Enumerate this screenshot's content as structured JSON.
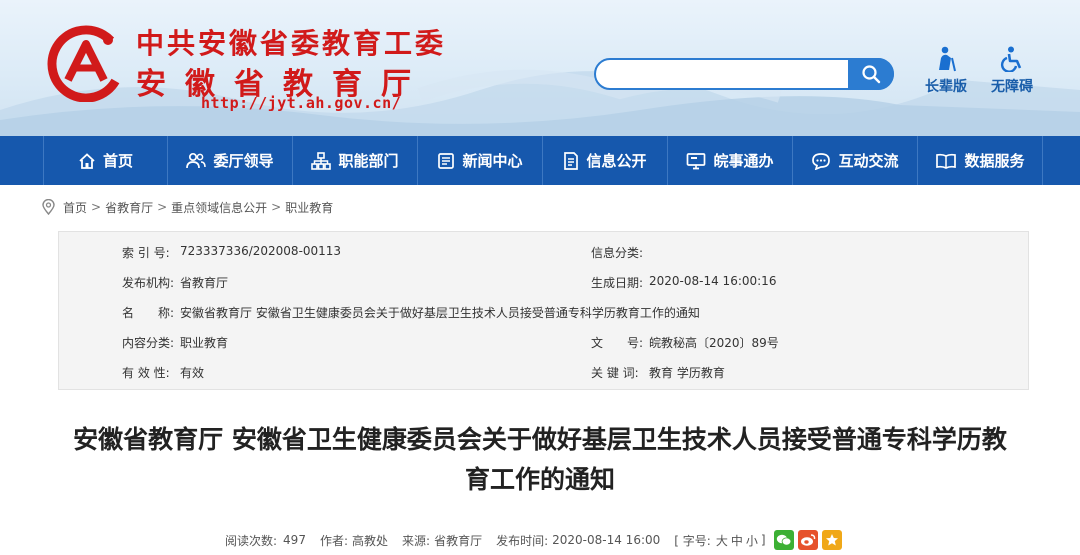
{
  "site": {
    "name_line1": "中共安徽省委教育工委",
    "name_line2": "安徽省教育厅",
    "url": "http://jyt.ah.gov.cn/",
    "brand_red": "#d11a1a",
    "nav_blue": "#1658ad"
  },
  "search": {
    "placeholder": "",
    "value": "",
    "icon": "search-icon"
  },
  "utilities": [
    {
      "label": "长辈版",
      "icon": "elder-icon"
    },
    {
      "label": "无障碍",
      "icon": "wheelchair-icon"
    }
  ],
  "nav": [
    {
      "label": "首页",
      "icon": "home-icon"
    },
    {
      "label": "委厅领导",
      "icon": "leaders-icon"
    },
    {
      "label": "职能部门",
      "icon": "org-chart-icon"
    },
    {
      "label": "新闻中心",
      "icon": "newspaper-icon"
    },
    {
      "label": "信息公开",
      "icon": "document-icon"
    },
    {
      "label": "皖事通办",
      "icon": "monitor-icon"
    },
    {
      "label": "互动交流",
      "icon": "chat-icon"
    },
    {
      "label": "数据服务",
      "icon": "book-icon"
    }
  ],
  "breadcrumb": [
    "首页",
    "省教育厅",
    "重点领域信息公开",
    "职业教育"
  ],
  "info": {
    "index_label": "索 引 号:",
    "index_value": "723337336/202008-00113",
    "category_label": "信息分类:",
    "category_value": "",
    "publisher_label": "发布机构:",
    "publisher_value": "省教育厅",
    "date_label": "生成日期:",
    "date_value": "2020-08-14 16:00:16",
    "name_label": "名　　称:",
    "name_value": "安徽省教育厅 安徽省卫生健康委员会关于做好基层卫生技术人员接受普通专科学历教育工作的通知",
    "content_label": "内容分类:",
    "content_value": "职业教育",
    "docno_label": "文　　号:",
    "docno_value": "皖教秘高〔2020〕89号",
    "valid_label": "有 效 性:",
    "valid_value": "有效",
    "keywords_label": "关 键 词:",
    "keywords_value": "教育 学历教育"
  },
  "article": {
    "title_line1": "安徽省教育厅 安徽省卫生健康委员会关于做好基层卫生技术人员接受普通专科学历教",
    "title_line2": "育工作的通知",
    "reads_label": "阅读次数:",
    "reads_value": "497",
    "author_label": "作者:",
    "author_value": "高教处",
    "source_label": "来源:",
    "source_value": "省教育厅",
    "time_label": "发布时间:",
    "time_value": "2020-08-14 16:00",
    "font_label": "[ 字号:",
    "font_large": "大",
    "font_medium": "中",
    "font_small": "小",
    "font_close": "]"
  },
  "share": [
    {
      "icon": "wechat-icon",
      "color": "#3cb034"
    },
    {
      "icon": "weibo-icon",
      "color": "#e6522c"
    },
    {
      "icon": "favorite-icon",
      "color": "#f0a818"
    }
  ]
}
